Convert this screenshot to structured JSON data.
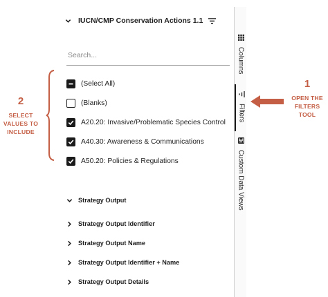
{
  "panel": {
    "header_title": "IUCN/CMP Conservation Actions 1.1",
    "search_placeholder": "Search...",
    "values": [
      {
        "label": "(Select All)",
        "state": "indeterminate"
      },
      {
        "label": "(Blanks)",
        "state": "unchecked"
      },
      {
        "label": "A20.20: Invasive/Problematic Species Control",
        "state": "checked"
      },
      {
        "label": "A40.30: Awareness & Communications",
        "state": "checked"
      },
      {
        "label": "A50.20: Policies & Regulations",
        "state": "checked"
      }
    ],
    "groups": [
      {
        "label": "Strategy Output",
        "expanded": true
      },
      {
        "label": "Strategy Output Identifier",
        "expanded": false
      },
      {
        "label": "Strategy Output Name",
        "expanded": false
      },
      {
        "label": "Strategy Output Identifier + Name",
        "expanded": false
      },
      {
        "label": "Strategy Output Details",
        "expanded": false
      }
    ]
  },
  "side_tools": [
    {
      "label": "Columns",
      "icon": "columns-grid-icon"
    },
    {
      "label": "Filters",
      "icon": "filter-icon",
      "active": true
    },
    {
      "label": "Custom Data Views",
      "icon": "save-icon"
    }
  ],
  "annotations": {
    "step1_number": "1",
    "step1_line1": "OPEN THE",
    "step1_line2": "FILTERS",
    "step1_line3": "TOOL",
    "step2_number": "2",
    "step2_line1": "SELECT",
    "step2_line2": "VALUES TO",
    "step2_line3": "INCLUDE",
    "color": "#c45e44"
  }
}
